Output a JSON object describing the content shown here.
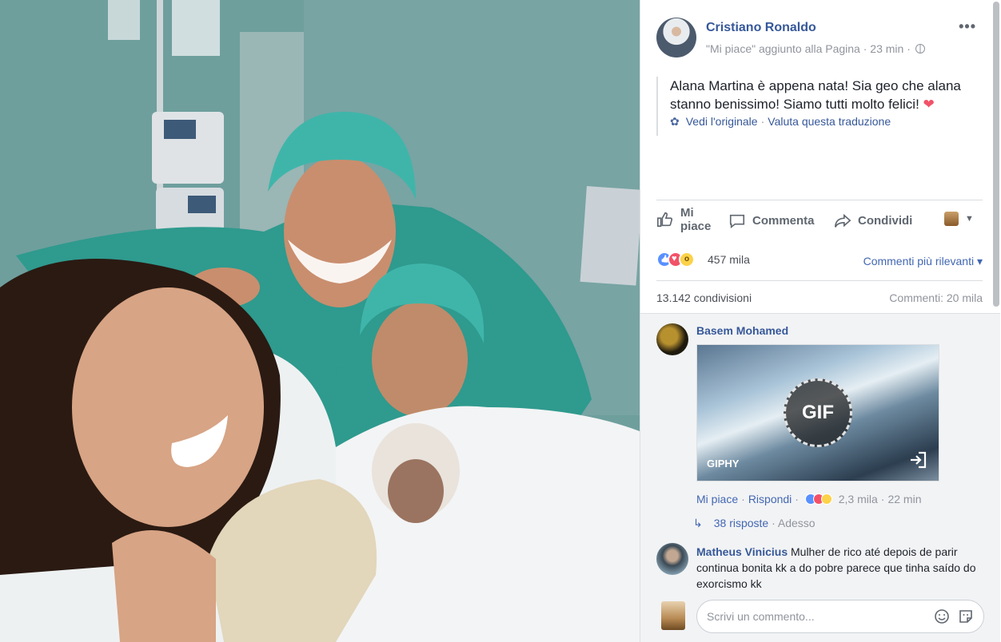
{
  "post": {
    "author": "Cristiano Ronaldo",
    "meta": "\"Mi piace\" aggiunto alla Pagina · 23 min ·",
    "text": "Alana Martina è appena nata! Sia geo che alana stanno benissimo! Siamo tutti molto felici!",
    "heart": "❤",
    "see_original": "Vedi l'originale",
    "separator": "·",
    "rate_translation": "Valuta questa traduzione",
    "more": "•••"
  },
  "actions": {
    "like": "Mi piace",
    "comment": "Commenta",
    "share": "Condividi"
  },
  "reactions": {
    "count": "457 mila",
    "sort": "Commenti più rilevanti ▾"
  },
  "stats": {
    "shares": "13.142 condivisioni",
    "comments": "Commenti: 20 mila"
  },
  "comments": [
    {
      "name": "Basem Mohamed",
      "gif_label": "GIF",
      "gif_source": "GIPHY",
      "like": "Mi piace",
      "reply": "Rispondi",
      "reaction_count": "2,3 mila",
      "time": "22 min",
      "replies": "38 risposte",
      "replies_time": "Adesso"
    },
    {
      "name": "Matheus Vinicius",
      "text": " Mulher de rico até depois de parir continua bonita kk a do pobre parece que tinha saído do exorcismo kk"
    }
  ],
  "composer": {
    "placeholder": "Scrivi un commento..."
  },
  "colors": {
    "link": "#365899",
    "accent": "#4267b2",
    "muted": "#90949c",
    "like_blue": "#5890ff",
    "love_red": "#f25268",
    "wow_yellow": "#fcd24a"
  }
}
